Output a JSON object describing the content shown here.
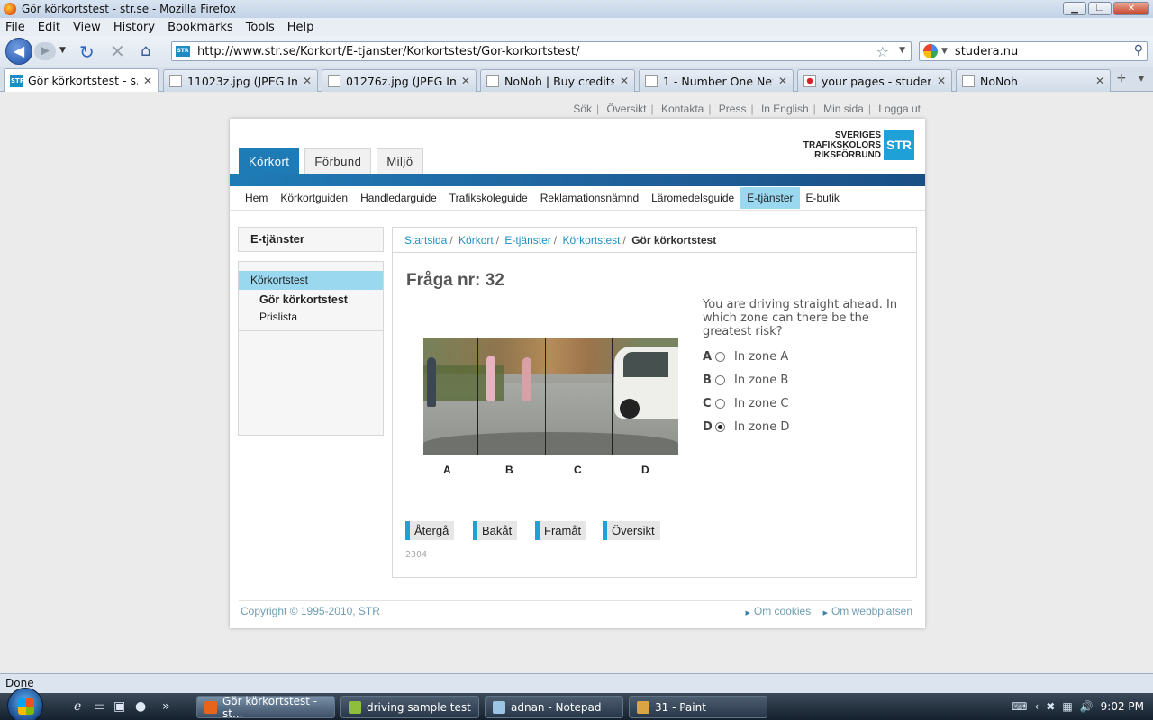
{
  "window": {
    "title": "Gör körkortstest - str.se - Mozilla Firefox"
  },
  "menu": [
    "File",
    "Edit",
    "View",
    "History",
    "Bookmarks",
    "Tools",
    "Help"
  ],
  "nav": {
    "url": "http://www.str.se/Korkort/E-tjanster/Korkortstest/Gor-korkortstest/",
    "search_value": "studera.nu",
    "site_icon": "STR"
  },
  "tabs": [
    {
      "label": "Gör körkortstest - s...",
      "icon": "str-icon"
    },
    {
      "label": "11023z.jpg (JPEG Ima...",
      "icon": "image-icon"
    },
    {
      "label": "01276z.jpg (JPEG Ima...",
      "icon": "image-icon"
    },
    {
      "label": "NoNoh | Buy credits ...",
      "icon": "page-icon"
    },
    {
      "label": "1 - Number One New...",
      "icon": "page-icon"
    },
    {
      "label": "your pages - studera....",
      "icon": "japan-flag-icon"
    },
    {
      "label": "NoNoh",
      "icon": "page-icon"
    }
  ],
  "site": {
    "top_links": [
      "Sök",
      "Översikt",
      "Kontakta",
      "Press",
      "In English",
      "Min sida",
      "Logga ut"
    ],
    "logo_lines": [
      "SVERIGES",
      "TRAFIKSKOLORS",
      "RIKSFÖRBUND"
    ],
    "logo_mark": "STR",
    "main_tabs": [
      "Körkort",
      "Förbund",
      "Miljö"
    ],
    "sub_nav": [
      "Hem",
      "Körkortguiden",
      "Handledarguide",
      "Trafikskoleguide",
      "Reklamationsnämnd",
      "Läromedelsguide",
      "E-tjänster",
      "E-butik"
    ],
    "sidebar": {
      "heading": "E-tjänster",
      "main_item": "Körkortstest",
      "sub_items": [
        "Gör körkortstest",
        "Prislista"
      ]
    },
    "breadcrumb": [
      "Startsida",
      "Körkort",
      "E-tjänster",
      "Körkortstest"
    ],
    "breadcrumb_current": "Gör körkortstest",
    "question_title": "Fråga nr: 32",
    "question_text": "You are driving straight ahead. In which zone can there be the greatest risk?",
    "zones": [
      "A",
      "B",
      "C",
      "D"
    ],
    "answers": [
      {
        "letter": "A",
        "text": "In zone A",
        "checked": false
      },
      {
        "letter": "B",
        "text": "In zone B",
        "checked": false
      },
      {
        "letter": "C",
        "text": "In zone C",
        "checked": false
      },
      {
        "letter": "D",
        "text": "In zone D",
        "checked": true
      }
    ],
    "buttons": [
      "Återgå",
      "Bakåt",
      "Framåt",
      "Översikt"
    ],
    "question_id": "2304",
    "copyright": "Copyright © 1995-2010, STR",
    "footer_links": [
      "Om cookies",
      "Om webbplatsen"
    ],
    "accent": "#1fa0d6",
    "brand_blue": "#1f7bb6"
  },
  "status": "Done",
  "taskbar": {
    "tasks": [
      "Gör körkortstest - st...",
      "driving sample test",
      "adnan - Notepad",
      "31 - Paint"
    ],
    "clock": "9:02 PM"
  }
}
